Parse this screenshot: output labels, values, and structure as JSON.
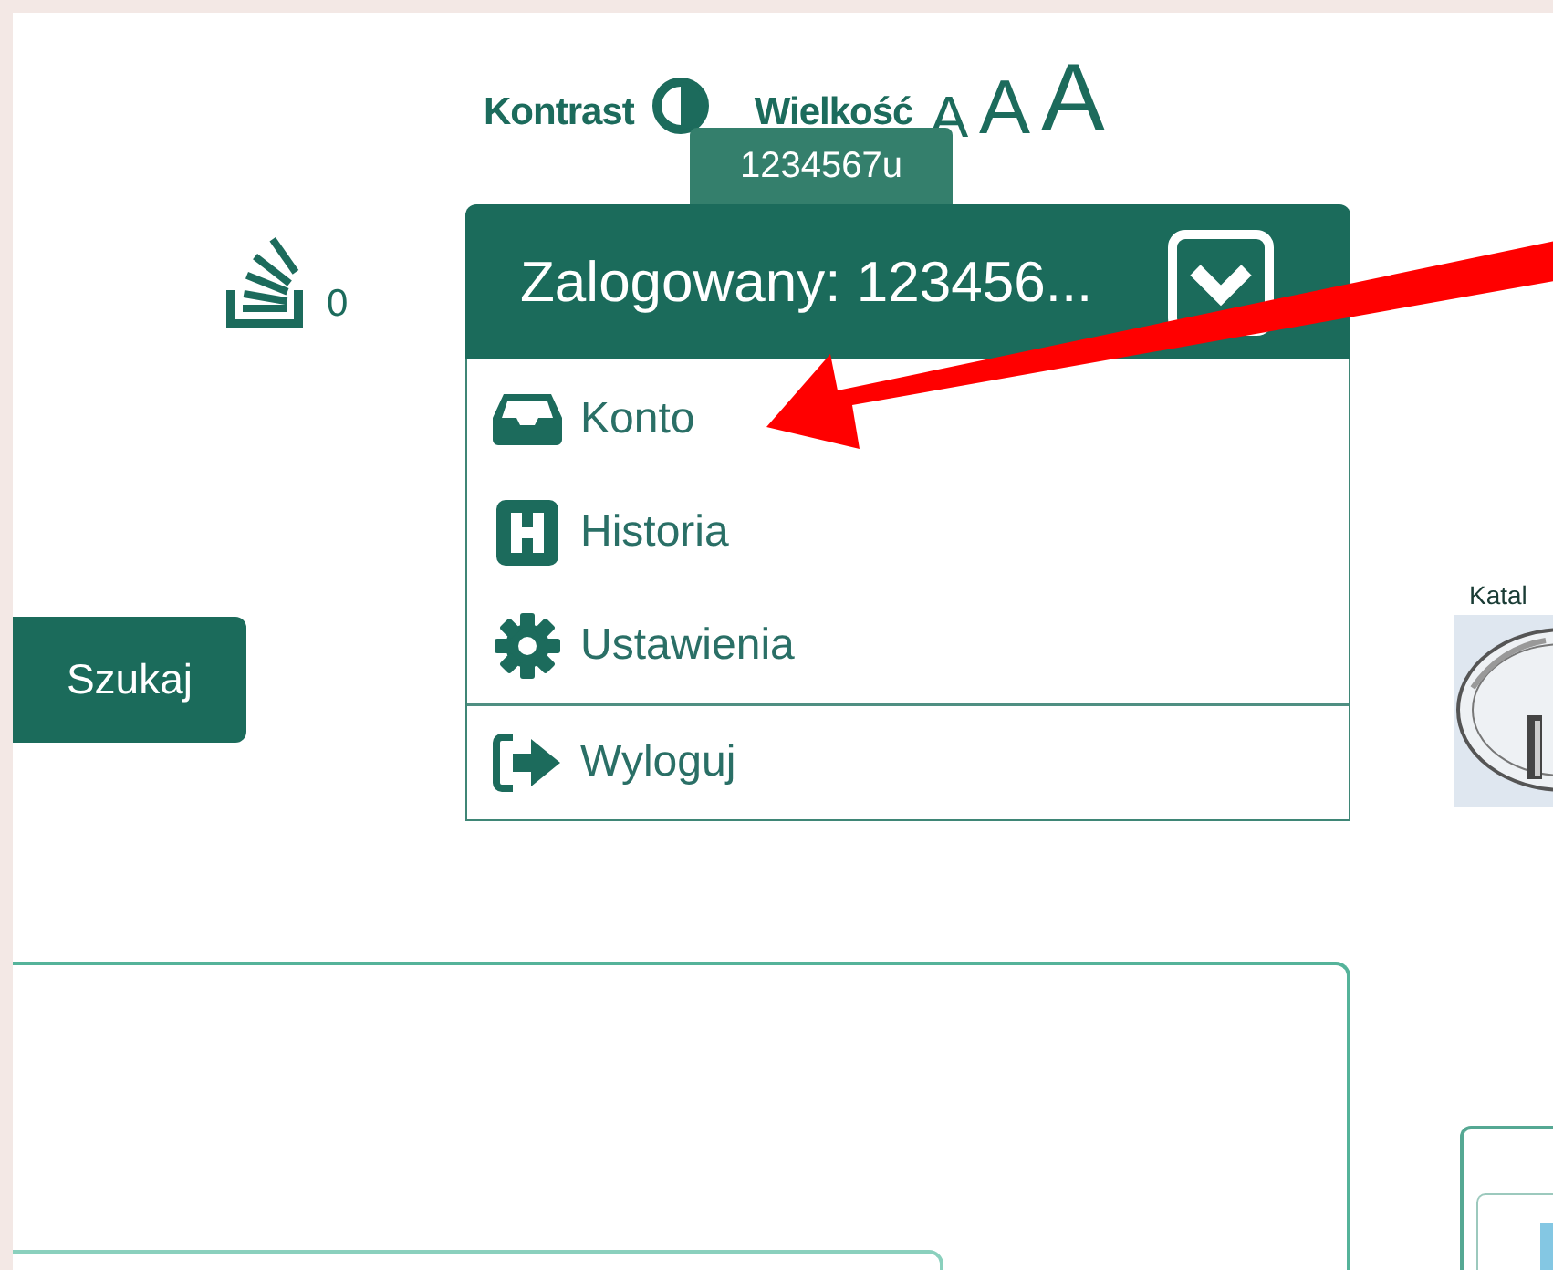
{
  "toolbar": {
    "contrast_label": "Kontrast",
    "size_label": "Wielkość",
    "size_options": [
      "A",
      "A",
      "A"
    ]
  },
  "tooltip": "1234567u",
  "basket": {
    "count": "0"
  },
  "account_button": {
    "label": "Zalogowany: 123456...",
    "expanded": true
  },
  "menu": [
    {
      "label": "Konto",
      "kind": "inbox",
      "divider_before": false
    },
    {
      "label": "Historia",
      "kind": "history",
      "divider_before": false
    },
    {
      "label": "Ustawienia",
      "kind": "settings",
      "divider_before": false
    },
    {
      "label": "Wyloguj",
      "kind": "logout",
      "divider_before": true
    }
  ],
  "search_button": "Szukaj",
  "catalog": {
    "label": "Katal"
  }
}
